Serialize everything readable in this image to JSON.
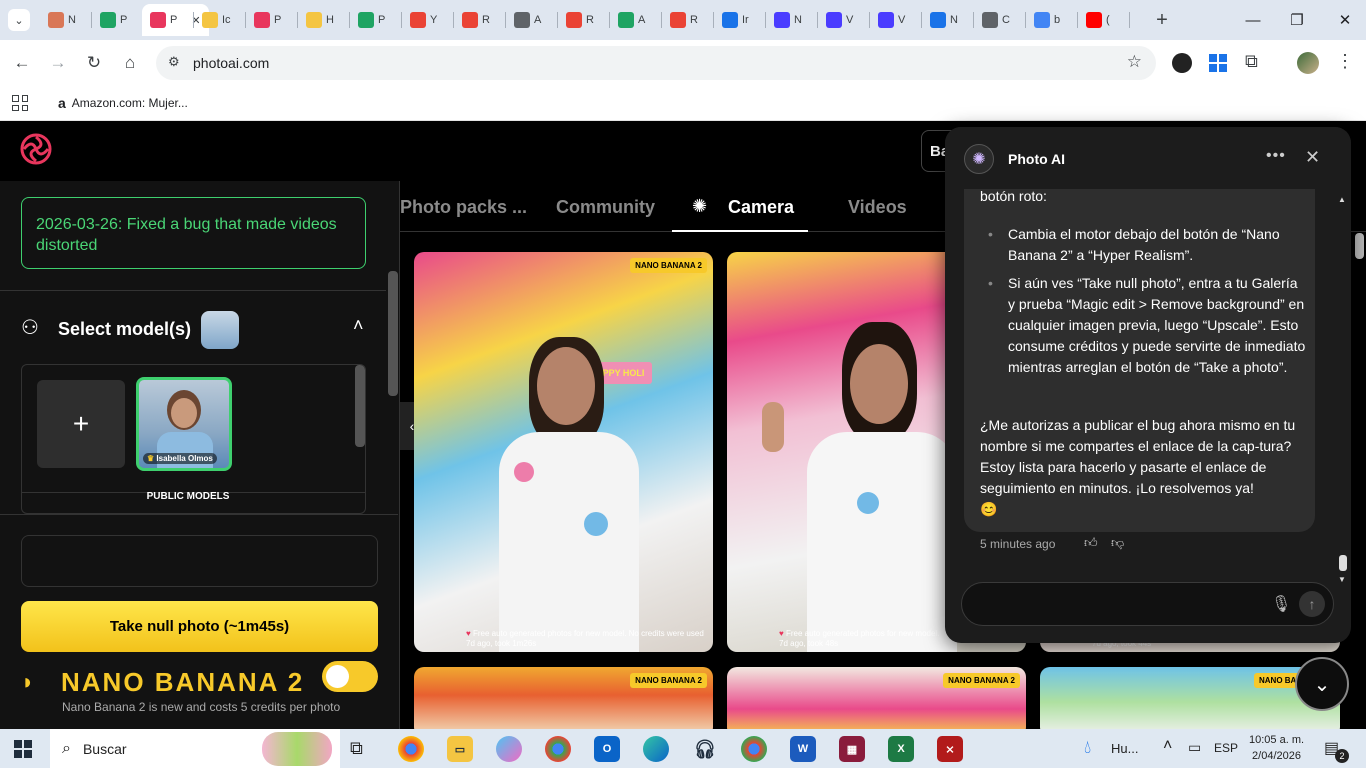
{
  "browser": {
    "tabs": [
      {
        "label": "N",
        "icon": "claude-icon",
        "color": "#d97757"
      },
      {
        "label": "P",
        "icon": "google-drive-icon",
        "color": "#1fa463"
      },
      {
        "label": "P",
        "icon": "photoai-icon",
        "color": "#e8365d",
        "active": true
      },
      {
        "label": "Ic",
        "icon": "lightbulb-icon",
        "color": "#f4c542"
      },
      {
        "label": "P",
        "icon": "photoai-icon",
        "color": "#e8365d"
      },
      {
        "label": "H",
        "icon": "lightbulb-icon",
        "color": "#f4c542"
      },
      {
        "label": "P",
        "icon": "google-drive-icon",
        "color": "#1fa463"
      },
      {
        "label": "Y",
        "icon": "gmail-icon",
        "color": "#ea4335"
      },
      {
        "label": "R",
        "icon": "gmail-icon",
        "color": "#ea4335"
      },
      {
        "label": "A",
        "icon": "globe-icon",
        "color": "#5f6368"
      },
      {
        "label": "R",
        "icon": "gmail-icon",
        "color": "#ea4335"
      },
      {
        "label": "A",
        "icon": "google-drive-icon",
        "color": "#1fa463"
      },
      {
        "label": "R",
        "icon": "gmail-icon",
        "color": "#ea4335"
      },
      {
        "label": "Ir",
        "icon": "chat-app-icon",
        "color": "#1a73e8"
      },
      {
        "label": "N",
        "icon": "heart-app-icon",
        "color": "#4a3cff"
      },
      {
        "label": "V",
        "icon": "video-icon",
        "color": "#4a3cff"
      },
      {
        "label": "V",
        "icon": "video-icon",
        "color": "#4a3cff"
      },
      {
        "label": "N",
        "icon": "chat-app-icon",
        "color": "#1a73e8"
      },
      {
        "label": "C",
        "icon": "openai-icon",
        "color": "#5f6368"
      },
      {
        "label": "b",
        "icon": "google-icon",
        "color": "#4285f4"
      },
      {
        "label": "(",
        "icon": "youtube-icon",
        "color": "#ff0000"
      }
    ],
    "url": "photoai.com",
    "bookmark": "Amazon.com: Mujer..."
  },
  "sidebar": {
    "bug_note": "2026-03-26: Fixed a bug that made videos distorted",
    "select_model": "Select model(s)",
    "model_name": "Isabella Olmos",
    "add_label": "+",
    "public_models": "PUBLIC MODELS",
    "take_photo": "Take null photo (~1m45s)",
    "nano_banana": "NANO BANANA 2",
    "nano_desc": "Nano Banana 2 is new and costs 5 credits per photo"
  },
  "header": {
    "button_partial": "Ba"
  },
  "page_tabs": [
    "Photo packs ...",
    "Community",
    "Camera",
    "Videos"
  ],
  "photos": {
    "badge": "NANO BANANA 2",
    "caption1_line1": "Free auto generated photos for new model. No credits were used",
    "caption1_line2": "7d ago, took 1m26s",
    "caption2_line1": "Free auto generated photos for new model.",
    "caption2_line2": "7d ago, took 48s",
    "caption3_line2": "7d ago, took 44s",
    "holi_sign": "HAPPY HOLI"
  },
  "chat": {
    "title": "Photo AI",
    "intro": "botón roto:",
    "bullet1": "Cambia el motor debajo del botón de “Nano Banana 2” a “Hyper Realism”.",
    "bullet2": "Si aún ves “Take null photo”, entra a tu Galería y prueba “Magic edit > Remove background” en cualquier imagen previa, luego “Upscale”. Esto consume créditos y puede servirte de inmediato mientras arreglan el botón de “Take a photo”.",
    "paragraph": "¿Me autorizas a publicar el bug ahora mismo en tu nombre si me compartes el enlace de la cap-tura? Estoy lista para hacerlo y pasarte el enlace de seguimiento en minutos. ¡Lo resolvemos ya!",
    "emoji": "😊",
    "timestamp": "5 minutes ago"
  },
  "taskbar": {
    "search": "Buscar",
    "weather": "Hu...",
    "lang": "ESP",
    "time": "10:05 a. m.",
    "date": "2/04/2026",
    "notif_count": "2"
  },
  "colors": {
    "green": "#4ad676",
    "yellow": "#f7c92a",
    "brand": "#e8365d"
  }
}
